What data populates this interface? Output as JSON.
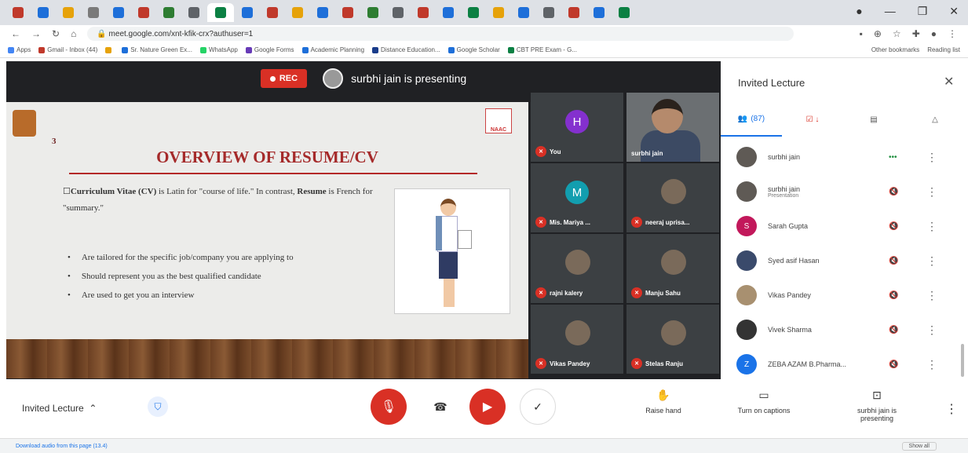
{
  "browser": {
    "tab_colors": [
      "#c0392b",
      "#1e6fd9",
      "#e6a20a",
      "#7a7a7a",
      "#1e6fd9",
      "#c0392b",
      "#2e7d32",
      "#5f6368",
      "#0b8043",
      "#1e6fd9",
      "#c0392b",
      "#e6a20a",
      "#1e6fd9",
      "#c0392b",
      "#2e7d32",
      "#5f6368",
      "#c0392b",
      "#1e6fd9",
      "#0b8043",
      "#e6a20a",
      "#1e6fd9",
      "#5f6368",
      "#c0392b",
      "#1e6fd9",
      "#0b8043"
    ],
    "url": "meet.google.com/xnt-kfik-crx?authuser=1",
    "bookmarks": [
      "Apps",
      "Gmail - Inbox (44)",
      "",
      "Sr. Nature Green Ex...",
      "WhatsApp",
      "Google Forms",
      "Academic Planning",
      "Distance Education...",
      "Google Scholar",
      "CBT PRE Exam - G..."
    ],
    "bookmarks_right": [
      "Other bookmarks",
      "Reading list"
    ]
  },
  "meet": {
    "rec_label": "REC",
    "presenting_text": "surbhi jain is presenting"
  },
  "slide": {
    "number": "3",
    "logo_text": "NAAC",
    "title": "OVERVIEW OF RESUME/CV",
    "intro_bold1": "Curriculum Vitae (CV)",
    "intro_rest1": " is Latin for \"course of life.\" In contrast, ",
    "intro_bold2": "Resume",
    "intro_rest2": " is French for \"summary.\"",
    "bullets": [
      "Are tailored for the specific job/company you are applying to",
      "Should represent you as the best qualified candidate",
      "Are used to get you an interview"
    ]
  },
  "tiles": [
    {
      "name": "You",
      "initial": "H",
      "color": "#8430ce"
    },
    {
      "name": "surbhi jain",
      "initial": "",
      "color": ""
    },
    {
      "name": "Mis. Mariya ...",
      "initial": "M",
      "color": "#129eaf"
    },
    {
      "name": "neeraj uprisa...",
      "initial": "",
      "color": ""
    },
    {
      "name": "rajni kalery",
      "initial": "",
      "color": ""
    },
    {
      "name": "Manju Sahu",
      "initial": "",
      "color": ""
    },
    {
      "name": "Vikas Pandey",
      "initial": "",
      "color": ""
    },
    {
      "name": "Stelas Ranju",
      "initial": "",
      "color": ""
    }
  ],
  "panel": {
    "title": "Invited Lecture",
    "tabs": [
      "(87)",
      "",
      "",
      ""
    ],
    "participants": [
      {
        "name": "surbhi jain",
        "sub": "",
        "initial": "",
        "color": "#5f5a55",
        "mic": "•••"
      },
      {
        "name": "surbhi jain",
        "sub": "Presentation",
        "initial": "",
        "color": "#5f5a55",
        "mic": "🔇"
      },
      {
        "name": "Sarah Gupta",
        "sub": "",
        "initial": "S",
        "color": "#c2185b",
        "mic": "🔇"
      },
      {
        "name": "Syed asif Hasan",
        "sub": "",
        "initial": "",
        "color": "#3a4a6b",
        "mic": "🔇"
      },
      {
        "name": "Vikas Pandey",
        "sub": "",
        "initial": "",
        "color": "#a89070",
        "mic": "🔇"
      },
      {
        "name": "Vivek Sharma",
        "sub": "",
        "initial": "",
        "color": "#333333",
        "mic": "🔇"
      },
      {
        "name": "ZEBA AZAM B.Pharma...",
        "sub": "",
        "initial": "Z",
        "color": "#1a73e8",
        "mic": "🔇"
      }
    ]
  },
  "controls": {
    "meeting_name": "Invited Lecture",
    "raise_hand": "Raise hand",
    "captions": "Turn on captions",
    "presenting": "surbhi jain is presenting"
  },
  "download_bar": {
    "text": "Download audio from this page (13.4)",
    "show_all": "Show all"
  }
}
